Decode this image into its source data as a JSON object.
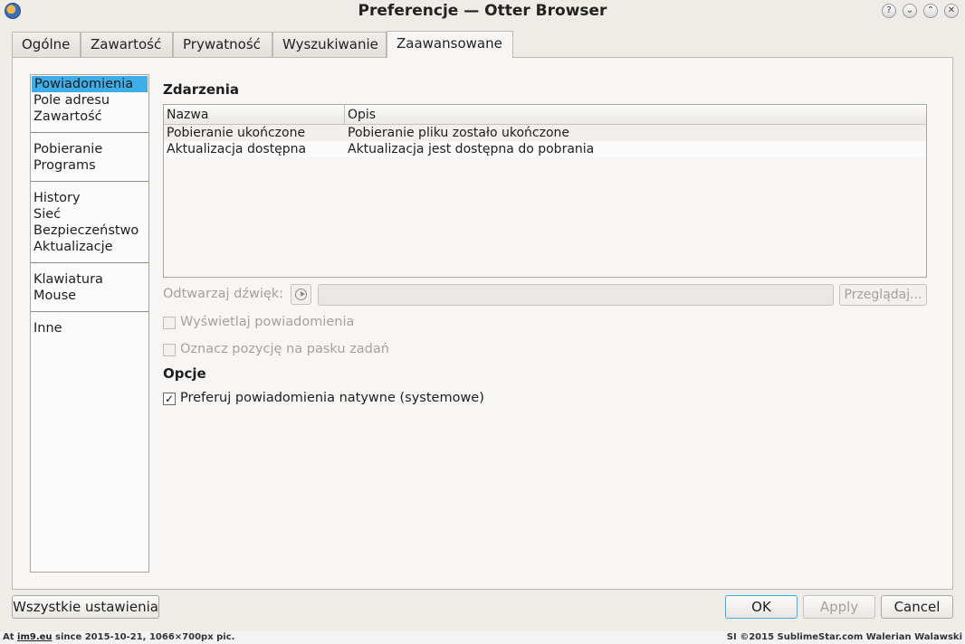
{
  "window": {
    "title": "Preferencje — Otter Browser",
    "buttons": [
      "?",
      "⌄",
      "⌃",
      "✕"
    ]
  },
  "tabs": [
    {
      "label": "Ogólne"
    },
    {
      "label": "Zawartość"
    },
    {
      "label": "Prywatność"
    },
    {
      "label": "Wyszukiwanie"
    },
    {
      "label": "Zaawansowane",
      "active": true
    }
  ],
  "categories": {
    "groups": [
      [
        "Powiadomienia",
        "Pole adresu",
        "Zawartość"
      ],
      [
        "Pobieranie",
        "Programs"
      ],
      [
        "History",
        "Sieć",
        "Bezpieczeństwo",
        "Aktualizacje"
      ],
      [
        "Klawiatura",
        "Mouse"
      ],
      [
        "Inne"
      ]
    ],
    "selected": "Powiadomienia"
  },
  "events": {
    "title": "Zdarzenia",
    "columns": [
      "Nazwa",
      "Opis"
    ],
    "rows": [
      [
        "Pobieranie ukończone",
        "Pobieranie pliku zostało ukończone"
      ],
      [
        "Aktualizacja dostępna",
        "Aktualizacja jest dostępna do pobrania"
      ]
    ]
  },
  "sound": {
    "label": "Odtwarzaj dźwięk:",
    "value": "",
    "browse_label": "Przeglądaj..."
  },
  "checkboxes": {
    "show_notification": {
      "label": "Wyświetlaj powiadomienia",
      "checked": false,
      "enabled": false
    },
    "mark_taskbar": {
      "label": "Oznacz pozycję na pasku zadań",
      "checked": false,
      "enabled": false
    }
  },
  "options": {
    "title": "Opcje",
    "prefer_native": {
      "label": "Preferuj powiadomienia natywne (systemowe)",
      "checked": true
    }
  },
  "footer": {
    "all_settings": "Wszystkie ustawienia",
    "ok": "OK",
    "apply": "Apply",
    "cancel": "Cancel"
  },
  "watermark": {
    "prefix": "At",
    "link": "im9.eu",
    "suffix": "since 2015-10-21, 1066×700px pic.",
    "right": "SI ©2015 SublimeStar.com Walerian Walawski"
  },
  "colors": {
    "selection": "#3daee9",
    "default_button_border": "#3daee9",
    "window_bg": "#efebe7"
  }
}
